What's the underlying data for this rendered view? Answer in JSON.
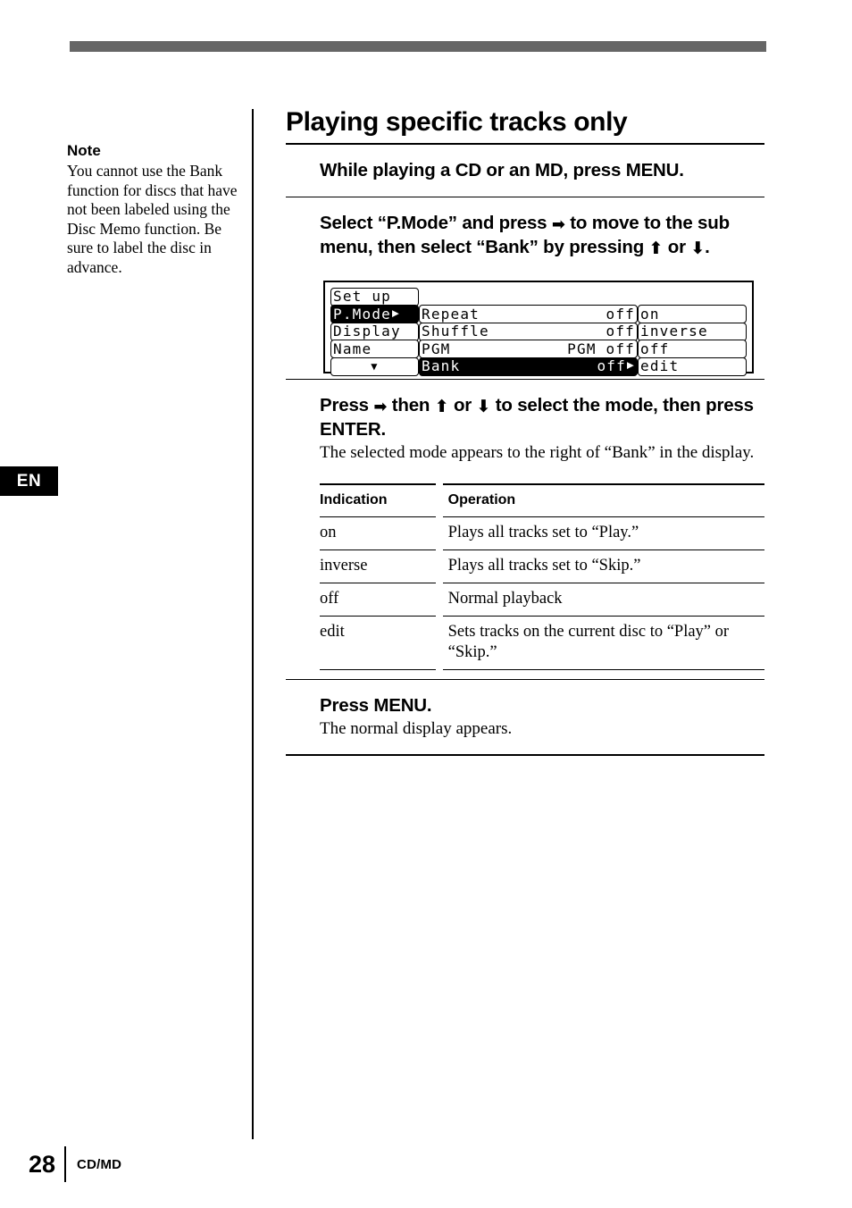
{
  "page": {
    "number": "28",
    "section_label": "CD/MD",
    "language_tab": "EN"
  },
  "note": {
    "title": "Note",
    "body": "You cannot use the Bank function for discs that have not been labeled using the Disc Memo function.  Be sure to label the disc in advance."
  },
  "main": {
    "title": "Playing specific tracks only",
    "steps": [
      {
        "heading_parts": [
          "While playing a CD or an MD, press MENU."
        ],
        "body": ""
      }
    ],
    "step1_heading": "While playing a CD or an MD, press MENU.",
    "step2": {
      "part1": "Select “P.Mode” and press ",
      "arrow_right": "➡",
      "part2": " to move to the sub menu, then select “Bank” by pressing ",
      "arrow_up": "⬆",
      "part3": " or ",
      "arrow_down": "⬇",
      "part4": "."
    },
    "step3": {
      "part1": "Press ",
      "arrow_right": "➡",
      "part2": " then ",
      "arrow_up": "⬆",
      "part3": " or ",
      "arrow_down": "⬇",
      "part4": " to select the mode, then press ENTER.",
      "body": "The selected mode appears to the right of “Bank” in the display."
    },
    "step4": {
      "heading": "Press MENU.",
      "body": "The normal display appears."
    }
  },
  "lcd": {
    "left_column": [
      {
        "label": "Set up",
        "value": "",
        "caret": "",
        "inverted": false,
        "center": false
      },
      {
        "label": "P.Mode",
        "value": "",
        "caret": "▶",
        "inverted": true,
        "center": false
      },
      {
        "label": "Display",
        "value": "",
        "caret": "",
        "inverted": false,
        "center": false
      },
      {
        "label": "Name",
        "value": "",
        "caret": "",
        "inverted": false,
        "center": false
      },
      {
        "label": "▼",
        "value": "",
        "caret": "",
        "inverted": false,
        "center": true
      }
    ],
    "middle_column": [
      {
        "label": "Repeat",
        "value": "off",
        "caret": "",
        "inverted": false
      },
      {
        "label": "Shuffle",
        "value": "off",
        "caret": "",
        "inverted": false
      },
      {
        "label": "PGM",
        "value": "PGM off",
        "caret": "",
        "inverted": false
      },
      {
        "label": "Bank",
        "value": "off",
        "caret": "▶",
        "inverted": true
      }
    ],
    "right_column": [
      {
        "label": "on",
        "inverted": false
      },
      {
        "label": "inverse",
        "inverted": false
      },
      {
        "label": "off",
        "inverted": false
      },
      {
        "label": "edit",
        "inverted": false
      }
    ]
  },
  "table": {
    "headers": [
      "Indication",
      "Operation"
    ],
    "rows": [
      {
        "indication": "on",
        "operation": "Plays all tracks set to “Play.”"
      },
      {
        "indication": "inverse",
        "operation": "Plays all tracks set to “Skip.”"
      },
      {
        "indication": "off",
        "operation": "Normal playback"
      },
      {
        "indication": "edit",
        "operation": "Sets tracks on the current disc to “Play” or “Skip.”"
      }
    ]
  },
  "colors": {
    "top_bar": "#666666",
    "ink": "#000000",
    "paper": "#ffffff"
  }
}
